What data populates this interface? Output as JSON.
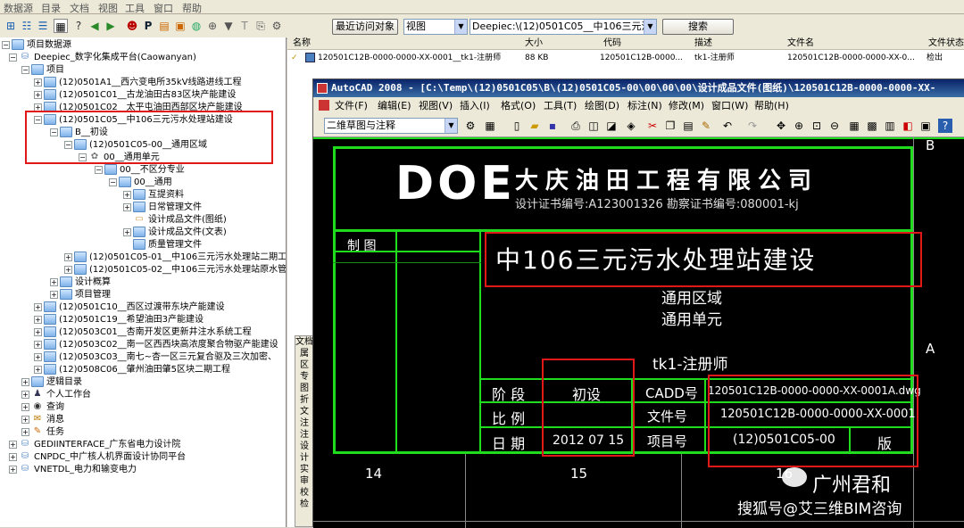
{
  "menu": {
    "items": [
      "数据源",
      "目录",
      "文档",
      "视图",
      "工具",
      "窗口",
      "帮助"
    ]
  },
  "toolbar": {
    "recent_button": "最近访问对象",
    "view_select": "视图",
    "path_select": "Deepiec:\\(12)0501C05__中106三元污水",
    "search_button": "搜索"
  },
  "tree": {
    "root": "项目数据源",
    "platform": "Deepiec_数字化集成平台(Caowanyan)",
    "projects": "项目",
    "p1": "(12)0501A1__西六变电所35kV线路进线工程",
    "p2": "(12)0501C01__古龙油田古83区块产能建设",
    "p3": "(12)0501C02__太平屯油田西部区块产能建设",
    "p4": "(12)0501C05__中106三元污水处理站建设",
    "stage": "B__初设",
    "area": "(12)0501C05-00__通用区域",
    "unit": "00__通用单元",
    "spec": "00__不区分专业",
    "general": "00__通用",
    "f1": "互提资料",
    "f2": "日常管理文件",
    "f3": "设计成品文件(图纸)",
    "f4": "设计成品文件(文表)",
    "f5": "质量管理文件",
    "a1": "(12)0501C05-01__中106三元污水处理站二期工",
    "a2": "(12)0501C05-02__中106三元污水处理站原水管",
    "budget": "设计概算",
    "pm": "项目管理",
    "p5": "(12)0501C10__西区过渡带东块产能建设",
    "p6": "(12)0501C19__希望油田3产能建设",
    "p7": "(12)0503C01__杏南开发区更新井注水系统工程",
    "p8": "(12)0503C02__南一区西西块高浓度聚合物驱产能建设",
    "p9": "(12)0503C03__南七~杏一区三元复合驱及三次加密、",
    "p10": "(12)0508C06__肇州油田肇5区块二期工程",
    "logic": "逻辑目录",
    "personal": "个人工作台",
    "query": "查询",
    "message": "消息",
    "task": "任务",
    "ds2": "GEDIINTERFACE_广东省电力设计院",
    "ds3": "CNPDC_中广核人机界面设计协同平台",
    "ds4": "VNETDL_电力和输变电力"
  },
  "list": {
    "headers": [
      "名称",
      "大小",
      "代码",
      "描述",
      "文件名",
      "文件状态"
    ],
    "row": {
      "name": "120501C12B-0000-0000-XX-0001__tk1-注册师",
      "size": "88 KB",
      "code": "120501C12B-0000...",
      "desc": "tk1-注册师",
      "filename": "120501C12B-0000-0000-XX-0...",
      "status": "检出"
    },
    "side_labels": [
      "文档",
      "属",
      "区",
      "专",
      "图",
      "折",
      "文",
      "注",
      "注",
      "设",
      "计",
      "实",
      "审",
      "校",
      "检"
    ]
  },
  "acad": {
    "title": "AutoCAD 2008 - [C:\\Temp\\(12)0501C05\\B\\(12)0501C05-00\\00\\00\\00\\设计成品文件(图纸)\\120501C12B-0000-0000-XX-",
    "menu": [
      "文件(F)",
      "编辑(E)",
      "视图(V)",
      "插入(I)",
      "格式(O)",
      "工具(T)",
      "绘图(D)",
      "标注(N)",
      "修改(M)",
      "窗口(W)",
      "帮助(H)"
    ],
    "workspace": "二维草图与注释"
  },
  "drawing": {
    "logo": "DOE",
    "company": "大庆油田工程有限公司",
    "cert": "设计证书编号:A123001326  勘察证书编号:080001-kj",
    "zhitu": "制 图",
    "project_title": "中106三元污水处理站建设",
    "area": "通用区域",
    "unit": "通用单元",
    "sheet_name": "tk1-注册师",
    "stage_label": "阶 段",
    "stage_value": "初设",
    "cadd_label": "CADD号",
    "cadd_value": "120501C12B-0000-0000-XX-0001A.dwg",
    "scale_label": "比 例",
    "file_label": "文件号",
    "file_value": "120501C12B-0000-0000-XX-0001",
    "date_label": "日 期",
    "date_value": "2012 07 15",
    "proj_label": "项目号",
    "proj_value": "(12)0501C05-00",
    "version_label": "版",
    "col14": "14",
    "col15": "15",
    "col16": "16",
    "border_b": "B",
    "border_a": "A"
  },
  "watermark": {
    "line1": "广州君和",
    "line2": "搜狐号@艾三维BIM咨询"
  }
}
